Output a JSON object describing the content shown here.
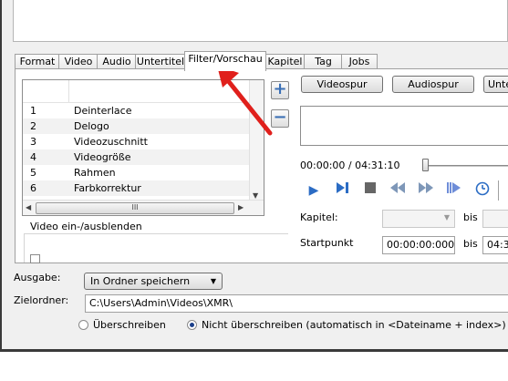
{
  "tabs": [
    {
      "label": "Format",
      "active": false
    },
    {
      "label": "Video",
      "active": false
    },
    {
      "label": "Audio",
      "active": false
    },
    {
      "label": "Untertitel",
      "active": false
    },
    {
      "label": "Filter/Vorschau",
      "active": true
    },
    {
      "label": "Kapitel",
      "active": false
    },
    {
      "label": "Tag",
      "active": false
    },
    {
      "label": "Jobs",
      "active": false
    }
  ],
  "filter_list": {
    "rows": [
      {
        "num": "1",
        "name": "Deinterlace"
      },
      {
        "num": "2",
        "name": "Delogo"
      },
      {
        "num": "3",
        "name": "Videozuschnitt"
      },
      {
        "num": "4",
        "name": "Videogröße"
      },
      {
        "num": "5",
        "name": "Rahmen"
      },
      {
        "num": "6",
        "name": "Farbkorrektur"
      }
    ],
    "hscroll_grip": "III"
  },
  "side_buttons": {
    "add": "+",
    "remove": "−"
  },
  "preview": {
    "videospur": "Videospur",
    "audiospur": "Audiospur",
    "third_button": "Unte",
    "time": "00:00:00 / 04:31:10"
  },
  "kapitel": {
    "label": "Kapitel:",
    "bis": "bis"
  },
  "startpunkt": {
    "label": "Startpunkt",
    "value": "00:00:00:000",
    "bis": "bis",
    "end_value": "04:3"
  },
  "group_label": "Video ein-/ausblenden",
  "ausgabe": {
    "label": "Ausgabe:",
    "value": "In Ordner speichern"
  },
  "zielordner": {
    "label": "Zielordner:",
    "value": "C:\\Users\\Admin\\Videos\\XMR\\"
  },
  "overwrite": {
    "option1": "Überschreiben",
    "option2": "Nicht überschreiben (automatisch in <Dateiname + index>)",
    "selected": "option2"
  },
  "colors": {
    "annotation_arrow": "#e0201c",
    "player_icon": "#2b6cc4"
  }
}
